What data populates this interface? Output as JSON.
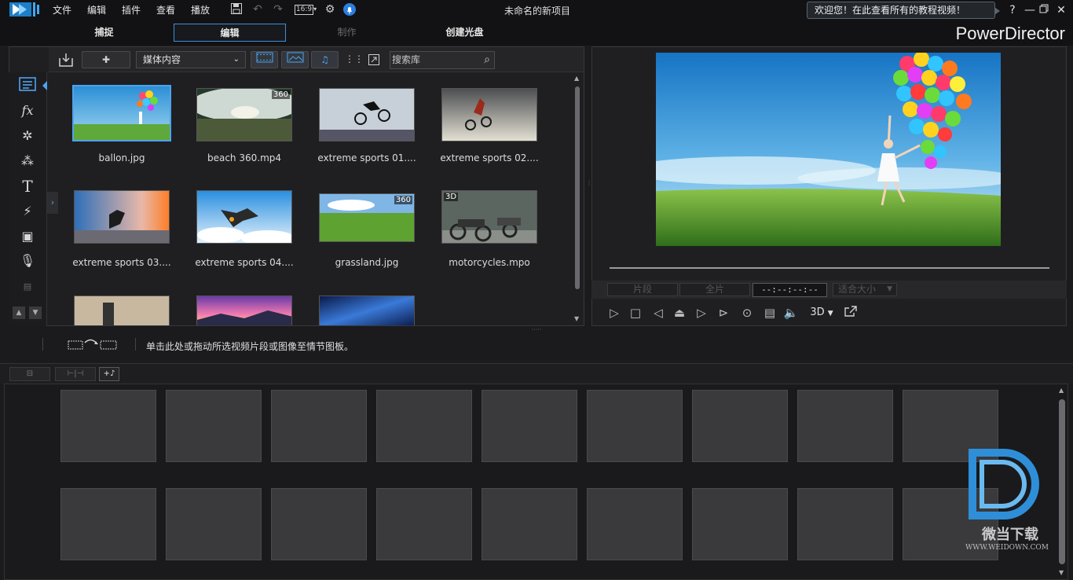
{
  "app": {
    "title": "未命名的新项目",
    "brand": "PowerDirector",
    "welcome": "欢迎您！在此查看所有的教程视频！",
    "menu": [
      "文件",
      "编辑",
      "插件",
      "查看",
      "播放"
    ],
    "aspect_ratio": "16:9",
    "help_label": "?"
  },
  "modes": [
    {
      "label": "捕捉",
      "state": "normal"
    },
    {
      "label": "编辑",
      "state": "active"
    },
    {
      "label": "制作",
      "state": "disabled"
    },
    {
      "label": "创建光盘",
      "state": "normal"
    }
  ],
  "library": {
    "dropdown": "媒体内容",
    "search_placeholder": "搜索库",
    "items": [
      {
        "label": "ballon.jpg",
        "badge": "",
        "selected": true
      },
      {
        "label": "beach 360.mp4",
        "badge": "360",
        "selected": false
      },
      {
        "label": "extreme sports 01....",
        "badge": "",
        "selected": false
      },
      {
        "label": "extreme sports 02....",
        "badge": "",
        "selected": false
      },
      {
        "label": "extreme sports 03....",
        "badge": "",
        "selected": false
      },
      {
        "label": "extreme sports 04....",
        "badge": "",
        "selected": false
      },
      {
        "label": "grassland.jpg",
        "badge": "360",
        "selected": false
      },
      {
        "label": "motorcycles.mpo",
        "badge": "3D",
        "selected": false
      },
      {
        "label": "",
        "badge": "",
        "selected": false
      },
      {
        "label": "",
        "badge": "",
        "selected": false
      },
      {
        "label": "",
        "badge": "",
        "selected": false
      }
    ]
  },
  "preview": {
    "clip_label": "片段",
    "full_label": "全片",
    "timecode": "--:--:--:--",
    "fit_label": "适合大小",
    "mode_3d": "3D"
  },
  "storyboard": {
    "hint": "单击此处或拖动所选视频片段或图像至情节图板。",
    "rows": 2,
    "cols": 9
  },
  "watermark": {
    "text": "微当下载",
    "url": "WWW.WEIDOWN.COM"
  },
  "colors": {
    "accent": "#4ea3ee",
    "background": "#1b1b1d",
    "cell": "#3a3a3c"
  }
}
